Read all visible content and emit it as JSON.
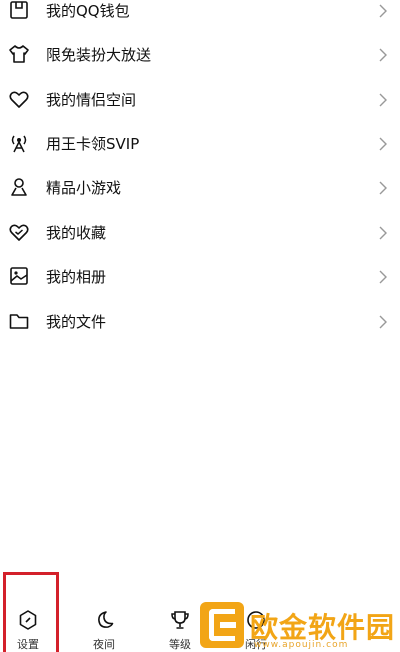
{
  "menu": {
    "items": [
      {
        "label": "我的QQ钱包",
        "icon": "wallet-icon"
      },
      {
        "label": "限免装扮大放送",
        "icon": "tshirt-icon"
      },
      {
        "label": "我的情侣空间",
        "icon": "heart-icon"
      },
      {
        "label": "用王卡领SVIP",
        "icon": "signal-tower-icon"
      },
      {
        "label": "精品小游戏",
        "icon": "location-pin-icon"
      },
      {
        "label": "我的收藏",
        "icon": "heart-check-icon"
      },
      {
        "label": "我的相册",
        "icon": "photo-album-icon"
      },
      {
        "label": "我的文件",
        "icon": "folder-icon"
      }
    ]
  },
  "bottom_bar": {
    "items": [
      {
        "label": "设置",
        "icon": "settings-hexagon-icon"
      },
      {
        "label": "夜间",
        "icon": "moon-icon"
      },
      {
        "label": "等级",
        "icon": "trophy-icon"
      },
      {
        "label": "闲行",
        "icon": "circle-icon"
      }
    ]
  },
  "watermark": {
    "title": "欧金软件园",
    "url": "www.apoujin.com"
  },
  "colors": {
    "highlight": "#d3202a",
    "watermark": "#f2a516",
    "text": "#111111"
  }
}
